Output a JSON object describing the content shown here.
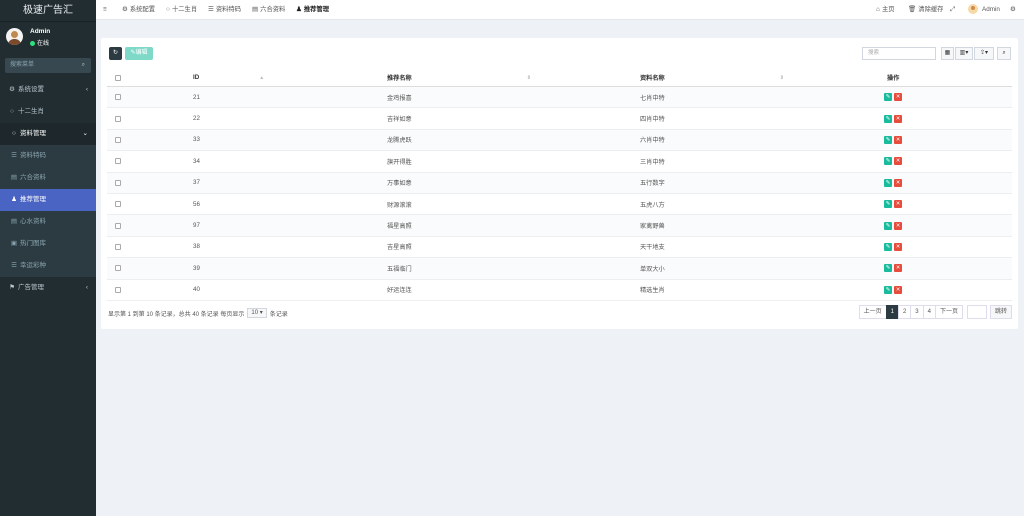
{
  "app": {
    "logo": "极速广告汇"
  },
  "user": {
    "name": "Admin",
    "status": "在线"
  },
  "sidebar": {
    "search_placeholder": "搜索菜单",
    "items": [
      {
        "label": "系统设置",
        "icon": "gear-icon"
      },
      {
        "label": "十二生肖",
        "icon": "circle-icon"
      },
      {
        "label": "资料管理",
        "icon": "circle-icon"
      }
    ],
    "sub_items": [
      {
        "label": "资料特码",
        "icon": "list-icon"
      },
      {
        "label": "六合资料",
        "icon": "doc-icon"
      },
      {
        "label": "推荐管理",
        "icon": "user-icon"
      },
      {
        "label": "心水资料",
        "icon": "doc-icon"
      },
      {
        "label": "热门图库",
        "icon": "image-icon"
      },
      {
        "label": "幸运彩种",
        "icon": "list-icon"
      }
    ],
    "bottom": {
      "label": "广告管理",
      "icon": "tag-icon"
    }
  },
  "topbar": {
    "menu": [
      "系统配置",
      "十二生肖",
      "资料特码",
      "六合资料",
      "推荐管理"
    ],
    "right": [
      "主页",
      "清除缓存",
      "Admin"
    ]
  },
  "toolbar": {
    "edit_label": "编辑",
    "search_placeholder": "搜索"
  },
  "table": {
    "headers": [
      "ID",
      "推荐名称",
      "资料名称",
      "操作"
    ],
    "rows": [
      {
        "id": "21",
        "name": "金鸡报喜",
        "data": "七肖中特"
      },
      {
        "id": "22",
        "name": "吉祥如意",
        "data": "四肖中特"
      },
      {
        "id": "33",
        "name": "龙腾虎跃",
        "data": "六肖中特"
      },
      {
        "id": "34",
        "name": "旗开得胜",
        "data": "三肖中特"
      },
      {
        "id": "37",
        "name": "万事如意",
        "data": "五行数字"
      },
      {
        "id": "56",
        "name": "财源滚滚",
        "data": "五虎八方"
      },
      {
        "id": "97",
        "name": "福星高照",
        "data": "家禽野兽"
      },
      {
        "id": "38",
        "name": "吉星高照",
        "data": "天干地支"
      },
      {
        "id": "39",
        "name": "五福临门",
        "data": "单双大小"
      },
      {
        "id": "40",
        "name": "好运连连",
        "data": "精选生肖"
      }
    ]
  },
  "footer": {
    "info": "显示第 1 到第 10 条记录，总共 40 条记录 每页显示",
    "page_size": "10",
    "info_suffix": "条记录"
  },
  "pager": {
    "prev": "上一页",
    "pages": [
      "1",
      "2",
      "3",
      "4"
    ],
    "next": "下一页",
    "go": "跳转"
  }
}
